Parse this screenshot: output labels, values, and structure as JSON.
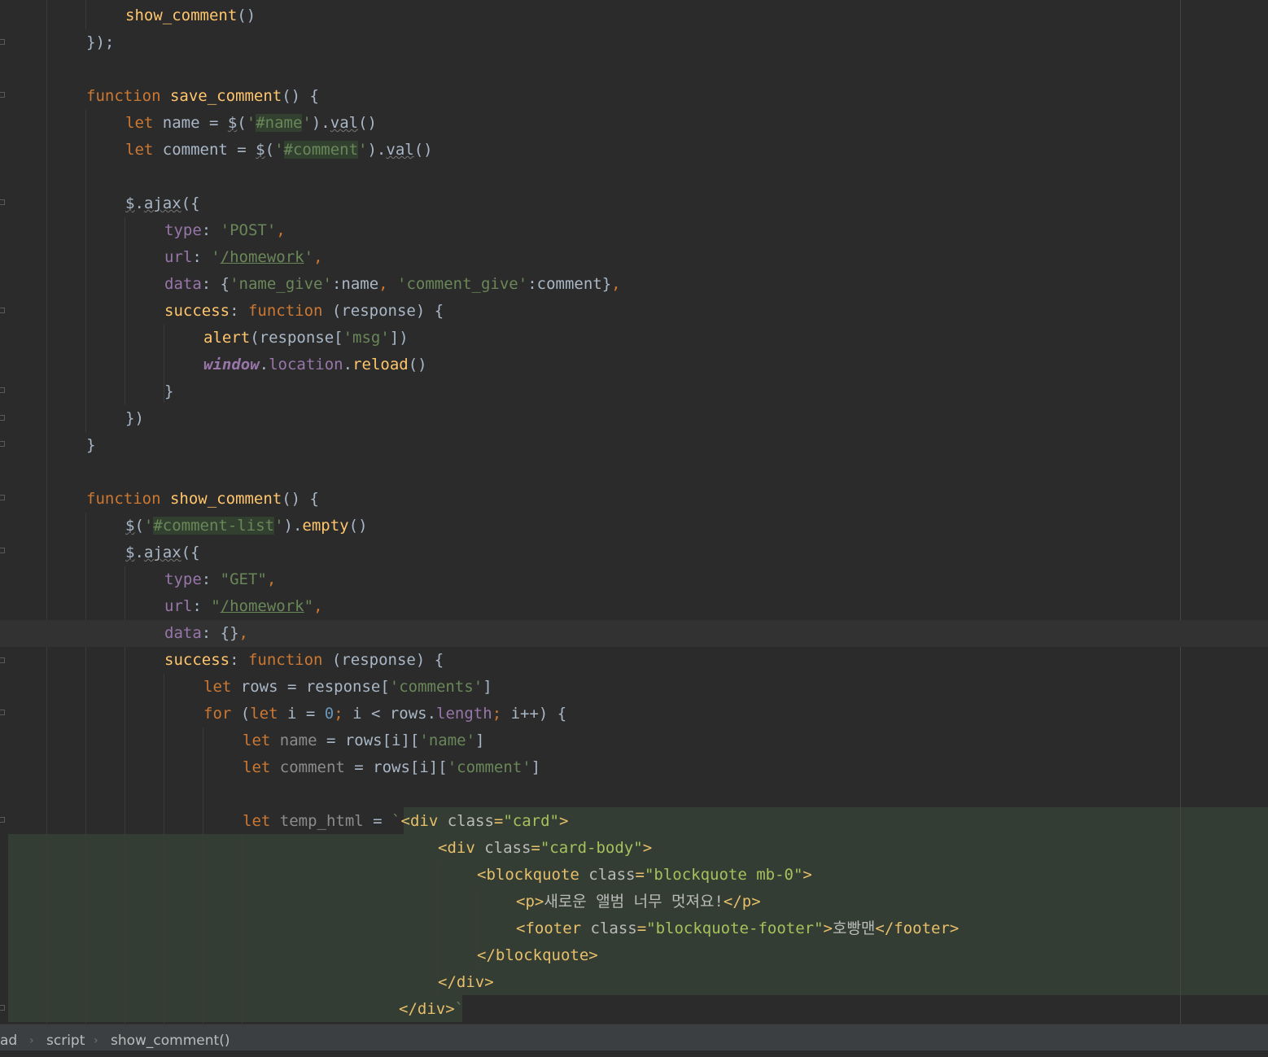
{
  "editor": {
    "lines": [
      [
        [
          "show_comment",
          "fn"
        ],
        [
          "()",
          ""
        ]
      ],
      [
        [
          "});",
          ""
        ]
      ],
      [],
      [
        [
          "function ",
          "k"
        ],
        [
          "save_comment",
          "fn"
        ],
        [
          "() {",
          ""
        ]
      ],
      [
        [
          "let ",
          "k"
        ],
        [
          "name = ",
          ""
        ],
        [
          "$",
          "sq"
        ],
        [
          "(",
          ""
        ],
        [
          "'",
          "s"
        ],
        [
          "#name",
          "s hl"
        ],
        [
          "'",
          "s"
        ],
        [
          ").",
          ""
        ],
        [
          "val",
          "sq"
        ],
        [
          "()",
          ""
        ]
      ],
      [
        [
          "let ",
          "k"
        ],
        [
          "comment = ",
          ""
        ],
        [
          "$",
          "sq"
        ],
        [
          "(",
          ""
        ],
        [
          "'",
          "s"
        ],
        [
          "#comment",
          "s hl"
        ],
        [
          "'",
          "s"
        ],
        [
          ").",
          ""
        ],
        [
          "val",
          "sq"
        ],
        [
          "()",
          ""
        ]
      ],
      [],
      [
        [
          "$",
          "sq"
        ],
        [
          ".",
          ""
        ],
        [
          "ajax",
          "sq"
        ],
        [
          "({",
          ""
        ]
      ],
      [
        [
          "type",
          "p"
        ],
        [
          ": ",
          ""
        ],
        [
          "'POST'",
          "s"
        ],
        [
          ",",
          "k"
        ]
      ],
      [
        [
          "url",
          "p"
        ],
        [
          ": ",
          ""
        ],
        [
          "'",
          "s"
        ],
        [
          "/homework",
          "s u"
        ],
        [
          "'",
          "s"
        ],
        [
          ",",
          "k"
        ]
      ],
      [
        [
          "data",
          "p"
        ],
        [
          ": {",
          ""
        ],
        [
          "'name_give'",
          "s"
        ],
        [
          ":name",
          ""
        ],
        [
          ", ",
          "k"
        ],
        [
          "'comment_give'",
          "s"
        ],
        [
          ":comment}",
          ""
        ],
        [
          ",",
          "k"
        ]
      ],
      [
        [
          "success",
          "fn"
        ],
        [
          ": ",
          ""
        ],
        [
          "function ",
          "k"
        ],
        [
          "(response) {",
          ""
        ]
      ],
      [
        [
          "alert",
          "fn"
        ],
        [
          "(response[",
          ""
        ],
        [
          "'msg'",
          "s"
        ],
        [
          "])",
          ""
        ]
      ],
      [
        [
          "window",
          "w"
        ],
        [
          ".",
          ""
        ],
        [
          "location",
          "p"
        ],
        [
          ".",
          ""
        ],
        [
          "reload",
          "fn"
        ],
        [
          "()",
          ""
        ]
      ],
      [
        [
          "}",
          ""
        ]
      ],
      [
        [
          "})",
          ""
        ]
      ],
      [
        [
          "}",
          ""
        ]
      ],
      [],
      [
        [
          "function ",
          "k"
        ],
        [
          "show_comment",
          "fn"
        ],
        [
          "() {",
          ""
        ]
      ],
      [
        [
          "$",
          "sq"
        ],
        [
          "(",
          ""
        ],
        [
          "'",
          "s"
        ],
        [
          "#comment-list",
          "s hl"
        ],
        [
          "'",
          "s"
        ],
        [
          ").",
          ""
        ],
        [
          "empty",
          "fn"
        ],
        [
          "()",
          ""
        ]
      ],
      [
        [
          "$",
          "sq"
        ],
        [
          ".",
          ""
        ],
        [
          "ajax",
          "sq"
        ],
        [
          "({",
          ""
        ]
      ],
      [
        [
          "type",
          "p"
        ],
        [
          ": ",
          ""
        ],
        [
          "\"GET\"",
          "s"
        ],
        [
          ",",
          "k"
        ]
      ],
      [
        [
          "url",
          "p"
        ],
        [
          ": ",
          ""
        ],
        [
          "\"",
          "s"
        ],
        [
          "/homework",
          "s u"
        ],
        [
          "\"",
          "s"
        ],
        [
          ",",
          "k"
        ]
      ],
      [
        [
          "data",
          "p"
        ],
        [
          ": {}",
          ""
        ],
        [
          ",",
          "k"
        ]
      ],
      [
        [
          "success",
          "fn"
        ],
        [
          ": ",
          ""
        ],
        [
          "function ",
          "k"
        ],
        [
          "(response) {",
          ""
        ]
      ],
      [
        [
          "let ",
          "k"
        ],
        [
          "rows = response[",
          ""
        ],
        [
          "'comments'",
          "s"
        ],
        [
          "]",
          ""
        ]
      ],
      [
        [
          "for ",
          "k"
        ],
        [
          "(",
          ""
        ],
        [
          "let ",
          "k"
        ],
        [
          "i = ",
          ""
        ],
        [
          "0",
          "n"
        ],
        [
          "; ",
          "k"
        ],
        [
          "i < rows.",
          ""
        ],
        [
          "length",
          "p"
        ],
        [
          "; ",
          "k"
        ],
        [
          "i++) {",
          ""
        ]
      ],
      [
        [
          "let ",
          "k"
        ],
        [
          "name",
          "g"
        ],
        [
          " = rows[i][",
          ""
        ],
        [
          "'name'",
          "s"
        ],
        [
          "]",
          ""
        ]
      ],
      [
        [
          "let ",
          "k"
        ],
        [
          "comment",
          "g"
        ],
        [
          " = rows[i][",
          ""
        ],
        [
          "'comment'",
          "s"
        ],
        [
          "]",
          ""
        ]
      ],
      [],
      [
        [
          "let ",
          "k"
        ],
        [
          "temp_html",
          "g"
        ],
        [
          " = ",
          ""
        ],
        [
          "`",
          "s"
        ],
        [
          "<div ",
          "tag"
        ],
        [
          "class",
          "at"
        ],
        [
          "=",
          "tag"
        ],
        [
          "\"card\"",
          "av"
        ],
        [
          ">",
          "tag"
        ]
      ],
      [
        [
          "<div ",
          "tag"
        ],
        [
          "class",
          "at"
        ],
        [
          "=",
          "tag"
        ],
        [
          "\"card-body\"",
          "av"
        ],
        [
          ">",
          "tag"
        ]
      ],
      [
        [
          "<blockquote ",
          "tag"
        ],
        [
          "class",
          "at"
        ],
        [
          "=",
          "tag"
        ],
        [
          "\"blockquote mb-0\"",
          "av"
        ],
        [
          ">",
          "tag"
        ]
      ],
      [
        [
          "<p>",
          "tag"
        ],
        [
          "새로운 앨범 너무 멋져요!",
          "at"
        ],
        [
          "</p>",
          "tag"
        ]
      ],
      [
        [
          "<footer ",
          "tag"
        ],
        [
          "class",
          "at"
        ],
        [
          "=",
          "tag"
        ],
        [
          "\"blockquote-footer\"",
          "av"
        ],
        [
          ">",
          "tag"
        ],
        [
          "호빵맨",
          "at"
        ],
        [
          "</footer>",
          "tag"
        ]
      ],
      [
        [
          "</blockquote>",
          "tag"
        ]
      ],
      [
        [
          "</div>",
          "tag"
        ]
      ],
      [
        [
          "</div>",
          "tag"
        ],
        [
          "`",
          "s"
        ]
      ]
    ]
  },
  "breadcrumb": {
    "items": [
      "ad",
      "script",
      "show_comment()"
    ],
    "separator": "›"
  },
  "colors": {
    "background": "#2b2b2b",
    "keyword": "#cc7832",
    "function": "#ffc66d",
    "string": "#6a8759",
    "property": "#9876aa",
    "number": "#6897bb",
    "injected_html_bg": "#333d33"
  }
}
